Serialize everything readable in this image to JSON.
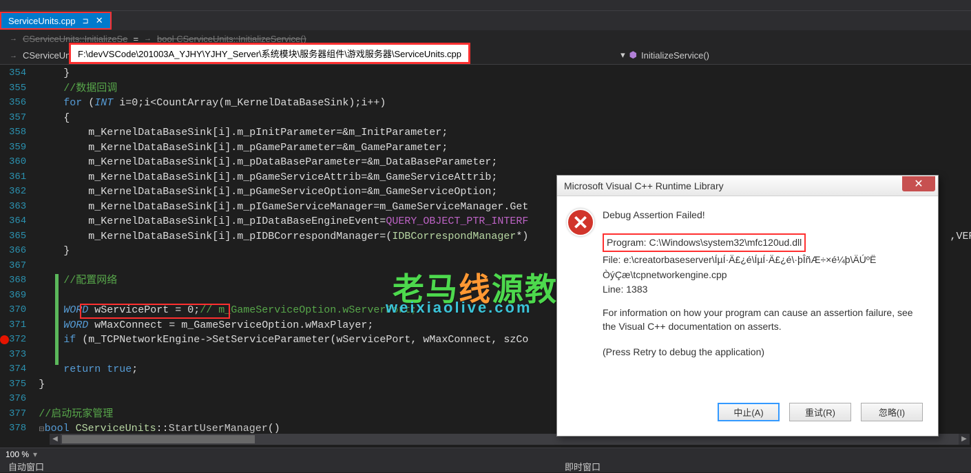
{
  "tab": {
    "name": "ServiceUnits.cpp",
    "pin_glyph": "⊐",
    "close_glyph": "✕"
  },
  "nav": {
    "row1_a": "CServiceUnits::InitializeSe",
    "row1_b": "bool CServiceUnits::InitializeService()",
    "row2": "CServiceUn",
    "method": "InitializeService()"
  },
  "tooltip_path": "F:\\devVSCode\\201003A_YJHY\\YJHY_Server\\系统模块\\服务器组件\\游戏服务器\\ServiceUnits.cpp",
  "zoom": "100 %",
  "bottom_tabs": {
    "left": "自动窗口",
    "right": "即时窗口"
  },
  "lines": [
    {
      "n": "354",
      "t": "    }"
    },
    {
      "n": "355",
      "t": "    //数据回调",
      "cls": "c-comment"
    },
    {
      "n": "356",
      "html": "    <span class='c-keyword'>for</span> (<span class='c-type'>INT</span> i=0;i&lt;<span class='c-func'>CountArray</span>(m_KernelDataBaseSink);i++)"
    },
    {
      "n": "357",
      "t": "    {"
    },
    {
      "n": "358",
      "html": "        m_KernelDataBaseSink[i].m_pInitParameter=&amp;m_InitParameter;"
    },
    {
      "n": "359",
      "html": "        m_KernelDataBaseSink[i].m_pGameParameter=&amp;m_GameParameter;"
    },
    {
      "n": "360",
      "html": "        m_KernelDataBaseSink[i].m_pDataBaseParameter=&amp;m_DataBaseParameter;"
    },
    {
      "n": "361",
      "html": "        m_KernelDataBaseSink[i].m_pGameServiceAttrib=&amp;m_GameServiceAttrib;"
    },
    {
      "n": "362",
      "html": "        m_KernelDataBaseSink[i].m_pGameServiceOption=&amp;m_GameServiceOption;"
    },
    {
      "n": "363",
      "html": "        m_KernelDataBaseSink[i].m_pIGameServiceManager=m_GameServiceManager.Get"
    },
    {
      "n": "364",
      "html": "        m_KernelDataBaseSink[i].m_pIDataBaseEngineEvent=<span class='c-macro'>QUERY_OBJECT_PTR_INTERF</span>"
    },
    {
      "n": "365",
      "html": "        m_KernelDataBaseSink[i].m_pIDBCorrespondManager=(<span class='c-iface'>IDBCorrespondManager</span>*)                                                                    ,VER_"
    },
    {
      "n": "366",
      "t": "    }"
    },
    {
      "n": "367",
      "t": ""
    },
    {
      "n": "368",
      "t": "    //配置网络",
      "cls": "c-comment"
    },
    {
      "n": "369",
      "t": ""
    },
    {
      "n": "370",
      "html": "    <span class='c-type'>WORD</span> wServicePort = 0;<span class='c-param-comment'>// m_GameServiceOption.wServerPort;</span>"
    },
    {
      "n": "371",
      "html": "    <span class='c-type'>WORD</span> wMaxConnect = m_GameServiceOption.wMaxPlayer;"
    },
    {
      "n": "372",
      "html": "    <span class='c-keyword'>if</span> (m_TCPNetworkEngine-&gt;<span class='c-func'>SetServiceParameter</span>(wServicePort, wMaxConnect, szCo"
    },
    {
      "n": "373",
      "t": ""
    },
    {
      "n": "374",
      "html": "    <span class='c-keyword'>return</span> <span class='c-keyword'>true</span>;"
    },
    {
      "n": "375",
      "t": "}"
    },
    {
      "n": "376",
      "t": ""
    },
    {
      "n": "377",
      "t": "//启动玩家管理",
      "cls": "c-comment"
    },
    {
      "n": "378",
      "html": "<span class='c-keyword'>bool</span> <span class='c-iface'>CServiceUnits</span>::<span class='c-funcname'>StartUserManager</span>()",
      "collapse": true
    }
  ],
  "breakpoint_line": "372",
  "dialog": {
    "title": "Microsoft Visual C++ Runtime Library",
    "heading": "Debug Assertion Failed!",
    "program": "Program: C:\\Windows\\system32\\mfc120ud.dll",
    "file": "File: e:\\creatorbaseserver\\ÍµÍ·Ä£¿é\\ÍµÍ·Ä£¿é\\·þÎñÆ÷×é¼þ\\ÄÚºË",
    "file2": "ÒýÇæ\\tcpnetworkengine.cpp",
    "line_info": "Line: 1383",
    "info": "For information on how your program can cause an assertion failure, see the Visual C++ documentation on asserts.",
    "press": "(Press Retry to debug the application)",
    "btn_abort": "中止(A)",
    "btn_retry": "重试(R)",
    "btn_ignore": "忽略(I)"
  },
  "watermark": {
    "big_a": "老马",
    "big_b": "线",
    "big_c": "源教程",
    "url": "weixiaolive.com"
  }
}
